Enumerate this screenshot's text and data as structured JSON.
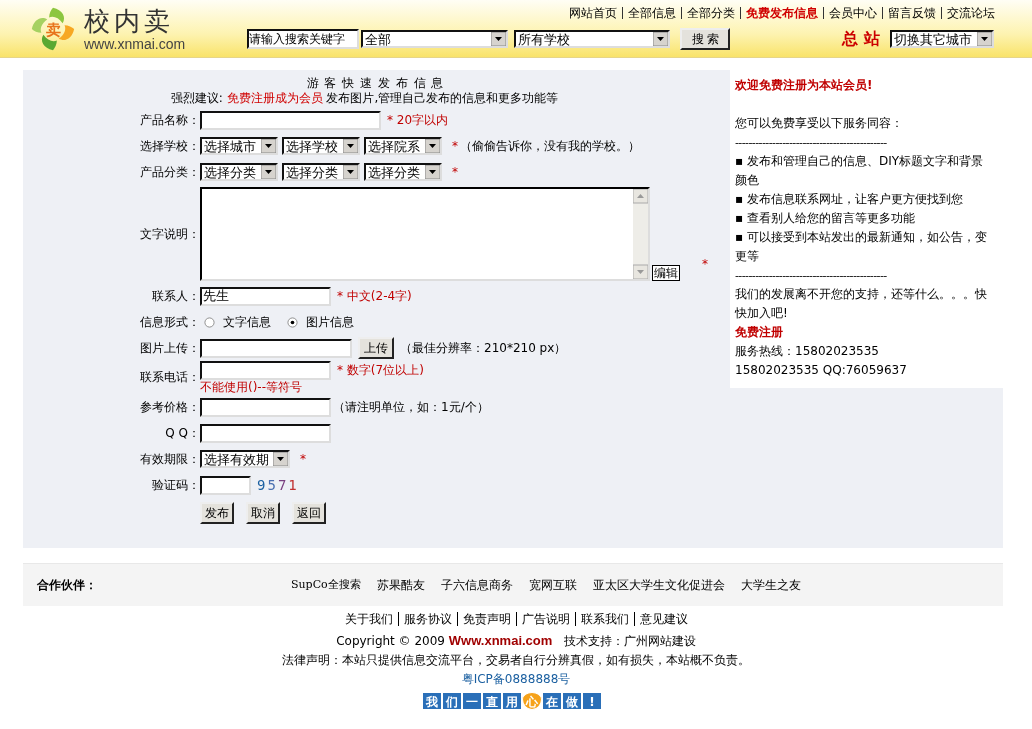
{
  "header": {
    "logo_mark": "卖",
    "logo_text": "校内卖",
    "domain": "www.xnmai.com",
    "nav": [
      {
        "label": "网站首页",
        "highlight": false
      },
      {
        "label": "全部信息",
        "highlight": false
      },
      {
        "label": "全部分类",
        "highlight": false
      },
      {
        "label": "免费发布信息",
        "highlight": true
      },
      {
        "label": "会员中心",
        "highlight": false
      },
      {
        "label": "留言反馈",
        "highlight": false
      },
      {
        "label": "交流论坛",
        "highlight": false
      }
    ],
    "search": {
      "value": "请输入搜索关键字",
      "category": "全部",
      "school": "所有学校",
      "button": "搜 索",
      "site_label": "总 站",
      "city": "切换其它城市"
    }
  },
  "form": {
    "title": "游 客 快 速 发 布 信 息",
    "advice": {
      "prefix": "强烈建议:",
      "link": "免费注册成为会员",
      "suffix": "发布图片,管理自己发布的信息和更多功能等"
    },
    "rows": [
      {
        "kind": "text",
        "label": "产品名称：",
        "value": "",
        "mark": "* 20字以内"
      },
      {
        "kind": "selects",
        "label": "选择学校：",
        "selects": [
          "选择城市",
          "选择学校",
          "选择院系"
        ],
        "mark": "*",
        "note": "（偷偷告诉你，没有我的学校。）"
      },
      {
        "kind": "selects",
        "label": "产品分类：",
        "selects": [
          "选择分类",
          "选择分类",
          "选择分类"
        ],
        "mark": "*"
      },
      {
        "kind": "textarea",
        "label": "文字说明：",
        "button": "编辑",
        "mark": "*"
      },
      {
        "kind": "text",
        "label": "联系人：",
        "value": "先生",
        "mark": "* 中文(2-4字)"
      },
      {
        "kind": "radio",
        "label": "信息形式：",
        "options": [
          {
            "label": "文字信息",
            "selected": false
          },
          {
            "label": "图片信息",
            "selected": true
          }
        ]
      },
      {
        "kind": "upload",
        "label": "图片上传：",
        "button": "上传",
        "note": "（最佳分辨率：210*210 px）"
      },
      {
        "kind": "text",
        "label": "联系电话：",
        "value": "",
        "mark": "* 数字(7位以上)",
        "error": "不能使用()--等符号"
      },
      {
        "kind": "text",
        "label": "参考价格：",
        "value": "",
        "note": "（请注明单位，如：1元/个）"
      },
      {
        "kind": "text",
        "label": "Q Q：",
        "value": ""
      },
      {
        "kind": "selects",
        "label": "有效期限：",
        "selects": [
          "选择有效期"
        ],
        "mark": "*"
      },
      {
        "kind": "captcha",
        "label": "验证码：",
        "value": "",
        "code": "9571"
      }
    ],
    "buttons": [
      "发布",
      "取消",
      "返回"
    ]
  },
  "member_panel": {
    "title": "欢迎免费注册为本站会员!",
    "intro": "您可以免费享受以下服务同容：",
    "divider": "---------------------------------------------",
    "benefits": [
      "▪ 发布和管理自己的信息、DIY标题文字和背景颜色",
      "▪ 发布信息联系网址，让客户更方便找到您",
      "▪ 查看别人给您的留言等更多功能",
      "▪ 可以接受到本站发出的最新通知，如公告，变更等"
    ],
    "divider_2": "---------------------------------------------",
    "closing": "我们的发展离不开您的支持，还等什么。。。快快加入吧!",
    "register": "免费注册",
    "hotline": "服务热线：15802023535",
    "contact": "15802023535 QQ:76059637"
  },
  "footer": {
    "partners_label": "合作伙伴：",
    "partners": [
      "SupCo全搜索",
      "苏果酷友",
      "子六信息商务",
      "宽网互联",
      "亚太区大学生文化促进会",
      "大学生之友"
    ],
    "links": [
      "关于我们",
      "服务协议",
      "免责声明",
      "广告说明",
      "联系我们",
      "意见建议"
    ],
    "copyright": "Copyright © 2009",
    "site": "Www.xnmai.com",
    "support": "技术支持：广州网站建设",
    "legal": "法律声明：本站只提供信息交流平台，交易者自行分辨真假，如有损失，本站概不负责。",
    "icp": "粤ICP备0888888号",
    "badge": [
      {
        "char": "我",
        "kind": "box"
      },
      {
        "char": "们",
        "kind": "box"
      },
      {
        "char": "一",
        "kind": "box"
      },
      {
        "char": "直",
        "kind": "box"
      },
      {
        "char": "用",
        "kind": "box"
      },
      {
        "char": "心",
        "kind": "heart"
      },
      {
        "char": "在",
        "kind": "box"
      },
      {
        "char": "做",
        "kind": "box"
      },
      {
        "char": "!",
        "kind": "box"
      }
    ]
  }
}
